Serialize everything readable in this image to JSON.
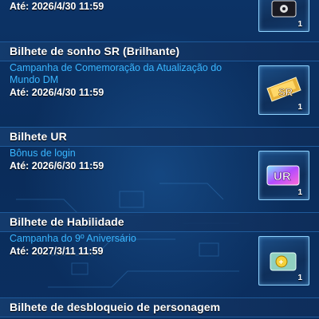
{
  "items": [
    {
      "title": "",
      "campaign": "",
      "date": "Até: 2026/4/30 11:59",
      "count": "1",
      "icon": "black-ticket-icon"
    },
    {
      "title": "Bilhete de sonho SR (Brilhante)",
      "campaign": "Campanha de Comemoração da Atualização do Mundo DM",
      "date": "Até: 2026/4/30 11:59",
      "count": "1",
      "icon": "sr-ticket-icon"
    },
    {
      "title": "Bilhete UR",
      "campaign": "Bônus de login",
      "date": "Até: 2026/6/30 11:59",
      "count": "1",
      "icon": "ur-ticket-icon"
    },
    {
      "title": "Bilhete de Habilidade",
      "campaign": "Campanha do 9º Aniversário",
      "date": "Até: 2027/3/11 11:59",
      "count": "1",
      "icon": "skill-ticket-icon"
    },
    {
      "title": "Bilhete de desbloqueio de personagem",
      "campaign": "",
      "date": "",
      "count": "",
      "icon": ""
    }
  ],
  "colors": {
    "campaign_text": "#39b6ff",
    "header_bg": "#143c6e",
    "icon_border": "#8fd3ff",
    "sr_gold": "#e8b23a",
    "ur_purple": "#b24cff"
  }
}
